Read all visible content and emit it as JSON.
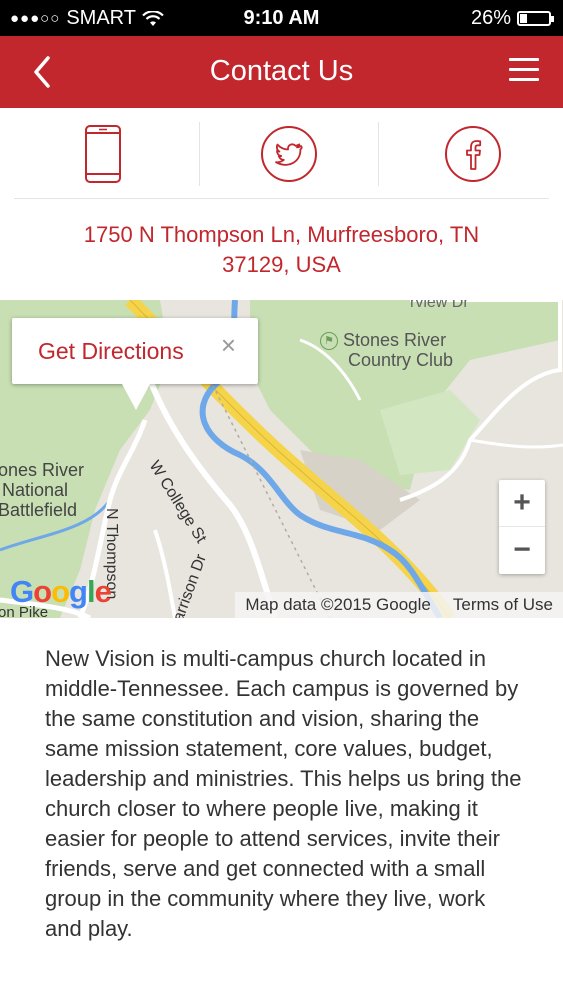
{
  "status_bar": {
    "signal": "●●●○○",
    "carrier": "SMART",
    "time": "9:10 AM",
    "battery": "26%"
  },
  "navbar": {
    "title": "Contact Us",
    "back_icon": "chevron-left-icon",
    "menu_icon": "hamburger-menu-icon"
  },
  "contact_icons": [
    "phone-icon",
    "twitter-icon",
    "facebook-icon"
  ],
  "address": {
    "line1": "1750 N Thompson Ln, Murfreesboro, TN",
    "line2": "37129, USA"
  },
  "map": {
    "popup_label": "Get Directions",
    "popup_close": "×",
    "zoom_in": "+",
    "zoom_out": "−",
    "labels": {
      "country_club_1": "Stones River",
      "country_club_2": "Country Club",
      "battlefield_1": "ones River",
      "battlefield_2": "National",
      "battlefield_3": "Battlefield",
      "college_st": "W College St",
      "thompson": "N Thompson",
      "garrison": "arrison Dr",
      "view_dr": "rview Dr",
      "pike": "on Pike"
    },
    "google_logo": "Google",
    "map_data": "Map data ©2015 Google",
    "terms": "Terms of Use"
  },
  "description": "New Vision is multi-campus church located in middle-Tennessee. Each campus is governed by the same constitution and vision, sharing the same mission statement, core values, budget, leadership and ministries. This helps us bring the church closer to where people live, making it easier for people to attend services, invite their friends, serve and get connected with a small group in the community where they live, work and play.",
  "colors": {
    "brand_red": "#c1272d",
    "park_green": "#c8dfb4",
    "water_blue": "#6fa8e8",
    "highway_yellow": "#f5d44a"
  }
}
